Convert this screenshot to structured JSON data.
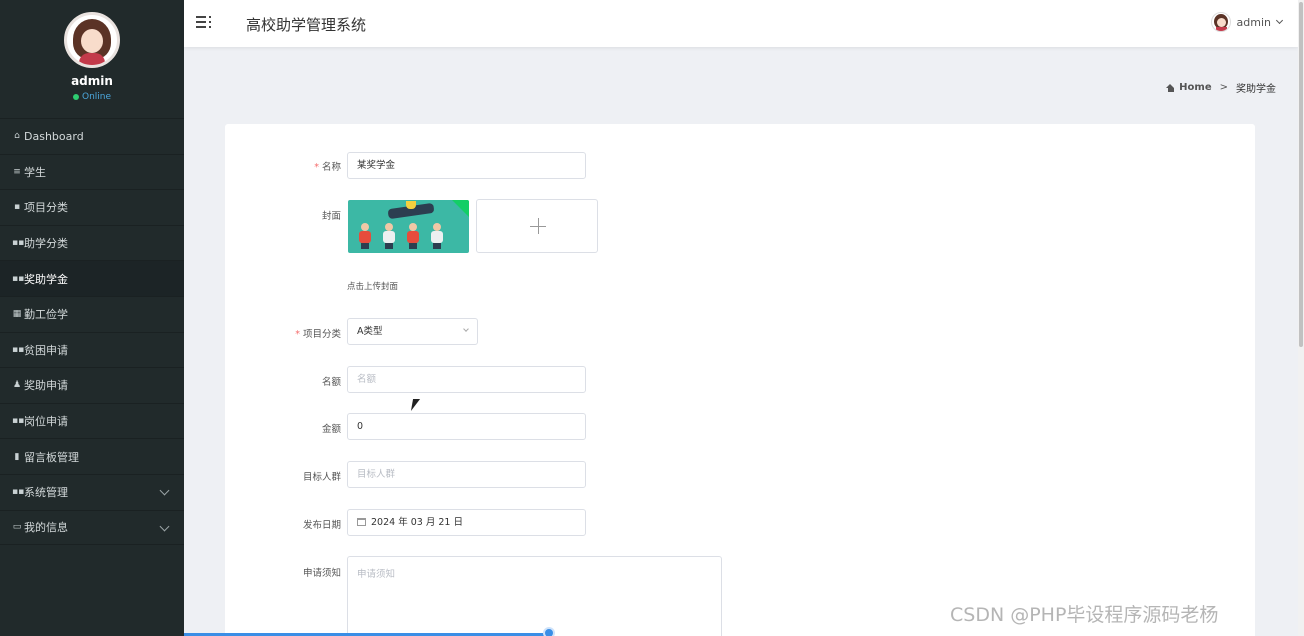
{
  "app": {
    "title": "高校助学管理系统",
    "user": "admin"
  },
  "sidebar": {
    "profile_name": "admin",
    "status": "Online",
    "items": [
      {
        "label": "Dashboard",
        "icon": "home-icon",
        "glyph": "⌂"
      },
      {
        "label": "学生",
        "icon": "list-icon",
        "glyph": "≡"
      },
      {
        "label": "项目分类",
        "icon": "bookmark-icon",
        "glyph": "▪"
      },
      {
        "label": "助学分类",
        "icon": "grid-icon",
        "glyph": "▪▪"
      },
      {
        "label": "奖助学金",
        "icon": "grid-icon",
        "glyph": "▪▪"
      },
      {
        "label": "勤工俭学",
        "icon": "table-icon",
        "glyph": "▦"
      },
      {
        "label": "贫困申请",
        "icon": "grid-icon",
        "glyph": "▪▪"
      },
      {
        "label": "奖助申请",
        "icon": "user-icon",
        "glyph": "♟"
      },
      {
        "label": "岗位申请",
        "icon": "grid-icon",
        "glyph": "▪▪"
      },
      {
        "label": "留言板管理",
        "icon": "bar-chart-icon",
        "glyph": "▮"
      },
      {
        "label": "系统管理",
        "icon": "grid-icon",
        "glyph": "▪▪"
      },
      {
        "label": "我的信息",
        "icon": "id-card-icon",
        "glyph": "▭"
      }
    ]
  },
  "breadcrumb": {
    "home": "Home",
    "separator": ">",
    "current": "奖助学金"
  },
  "form": {
    "name": {
      "label": "名称",
      "value": "某奖学金"
    },
    "cover": {
      "label": "封面",
      "hint": "点击上传封面"
    },
    "category": {
      "label": "项目分类",
      "value": "A类型"
    },
    "quota": {
      "label": "名额",
      "placeholder": "名额"
    },
    "amount": {
      "label": "金额",
      "value": "0"
    },
    "target": {
      "label": "目标人群",
      "placeholder": "目标人群"
    },
    "publish_date": {
      "label": "发布日期",
      "value": "2024 年 03 月 21 日"
    },
    "notice": {
      "label": "申请须知",
      "placeholder": "申请须知"
    }
  },
  "watermark": "CSDN @PHP毕设程序源码老杨",
  "colors": {
    "sidebar_bg": "#212a2b",
    "required": "#f56c6c",
    "online": "#2ecc71",
    "progress": "#3a8ee6"
  }
}
